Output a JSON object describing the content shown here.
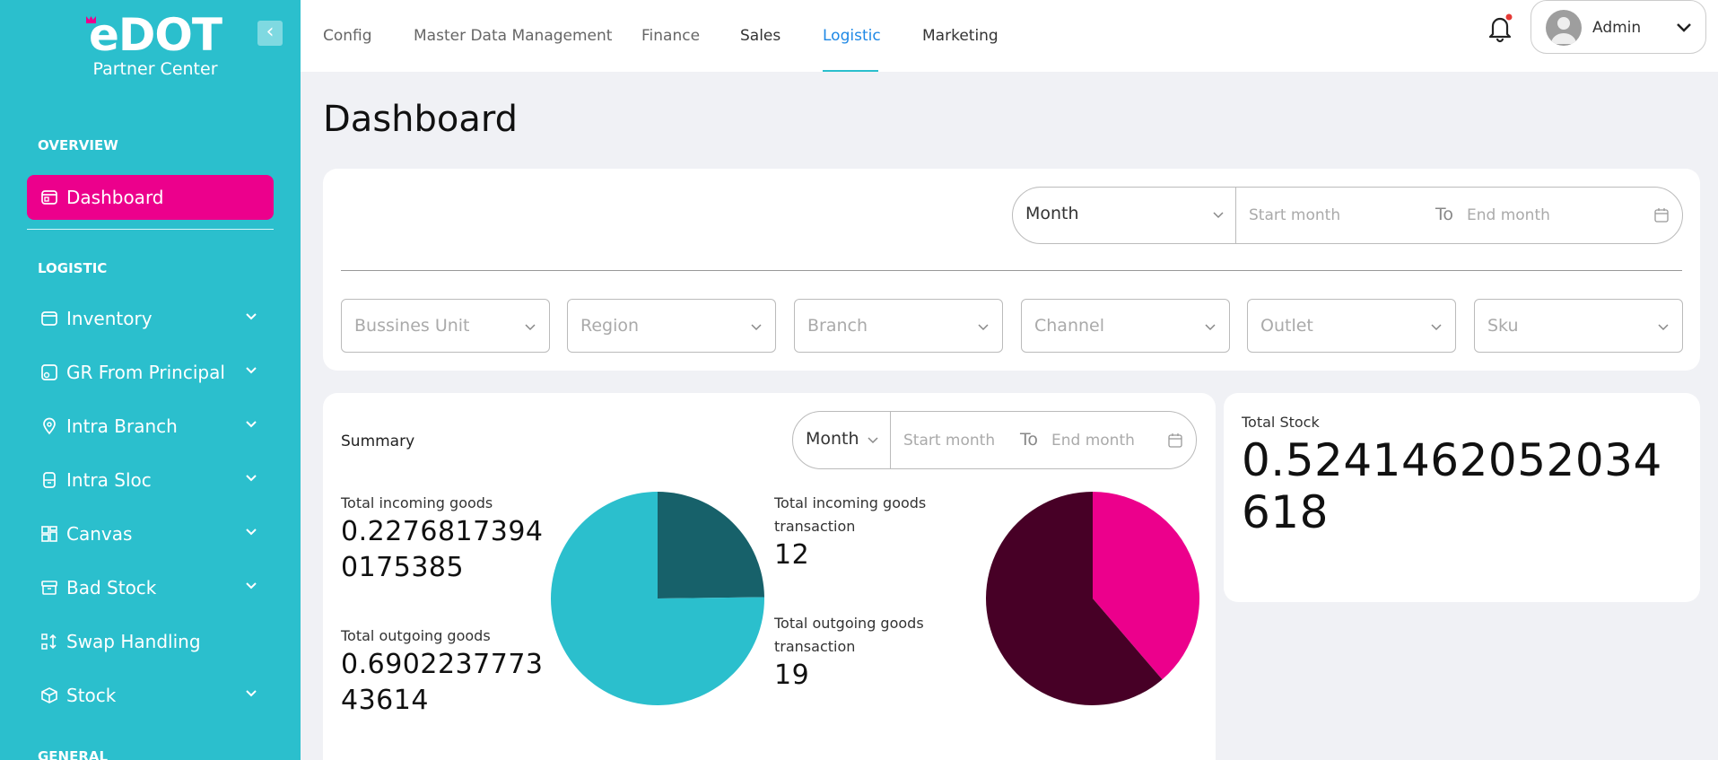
{
  "brand": {
    "logo": "eDOT",
    "subtitle": "Partner Center"
  },
  "sidebar": {
    "sections": {
      "overview": "OVERVIEW",
      "logistic": "LOGISTIC",
      "general": "GENERAL"
    },
    "items": [
      {
        "label": "Dashboard",
        "icon": "dashboard-icon"
      },
      {
        "label": "Inventory",
        "icon": "inventory-icon"
      },
      {
        "label": "GR From Principal",
        "icon": "gr-principal-icon"
      },
      {
        "label": "Intra Branch",
        "icon": "location-pin-icon"
      },
      {
        "label": "Intra Sloc",
        "icon": "intra-sloc-icon"
      },
      {
        "label": "Canvas",
        "icon": "canvas-icon"
      },
      {
        "label": "Bad Stock",
        "icon": "archive-icon"
      },
      {
        "label": "Swap Handling",
        "icon": "swap-icon"
      },
      {
        "label": "Stock",
        "icon": "cube-icon"
      }
    ]
  },
  "topnav": {
    "tabs": [
      "Config",
      "Master Data Management",
      "Finance",
      "Sales",
      "Logistic",
      "Marketing"
    ],
    "active_tab": "Logistic",
    "user": "Admin"
  },
  "page": {
    "title": "Dashboard"
  },
  "filters": {
    "period": "Month",
    "start_placeholder": "Start month",
    "to": "To",
    "end_placeholder": "End month",
    "selects": [
      "Bussines Unit",
      "Region",
      "Branch",
      "Channel",
      "Outlet",
      "Sku"
    ]
  },
  "summary": {
    "title": "Summary",
    "period": "Month",
    "start_placeholder": "Start month",
    "to": "To",
    "end_placeholder": "End month",
    "incoming_label": "Total incoming goods",
    "incoming_value": "0.22768173940175385",
    "outgoing_label": "Total outgoing goods",
    "outgoing_value": "0.690223777343614",
    "incoming_tx_label": "Total incoming goods transaction",
    "incoming_tx_value": "12",
    "outgoing_tx_label": "Total outgoing goods transaction",
    "outgoing_tx_value": "19"
  },
  "total_stock": {
    "label": "Total Stock",
    "value": "0.5241462052034618"
  },
  "chart_data": [
    {
      "type": "pie",
      "categories": [
        "Total incoming goods",
        "Total outgoing goods"
      ],
      "values": [
        0.22768173940175385,
        0.690223777343614
      ],
      "colors": [
        "#17616a",
        "#2bbfcd"
      ]
    },
    {
      "type": "pie",
      "categories": [
        "Total incoming goods transaction",
        "Total outgoing goods transaction"
      ],
      "values": [
        12,
        19
      ],
      "colors": [
        "#ec008c",
        "#470026"
      ]
    }
  ],
  "colors": {
    "sidebar": "#2bbfcd",
    "active": "#ec008c",
    "link": "#1e88e5"
  }
}
